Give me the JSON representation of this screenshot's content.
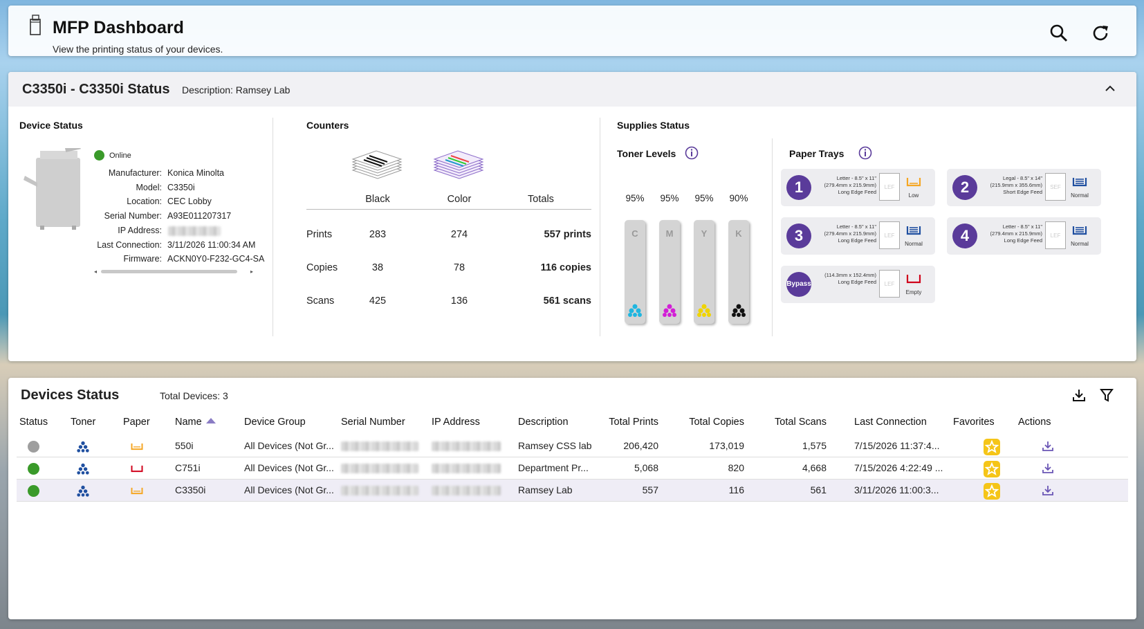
{
  "header": {
    "title": "MFP Dashboard",
    "subtitle": "View the printing status of your devices."
  },
  "device": {
    "title": "C3350i - C3350i Status",
    "description": "Description: Ramsey Lab",
    "status_heading": "Device Status",
    "online": "Online",
    "fields": [
      {
        "label": "Manufacturer:",
        "value": "Konica Minolta"
      },
      {
        "label": "Model:",
        "value": "C3350i"
      },
      {
        "label": "Location:",
        "value": "CEC Lobby"
      },
      {
        "label": "Serial Number:",
        "value": "A93E011207317"
      },
      {
        "label": "IP Address:",
        "value": ""
      },
      {
        "label": "Last Connection:",
        "value": "3/11/2026 11:00:34 AM"
      },
      {
        "label": "Firmware:",
        "value": "ACKN0Y0-F232-GC4-SA"
      }
    ]
  },
  "counters": {
    "heading": "Counters",
    "cols": [
      "Black",
      "Color",
      "Totals"
    ],
    "rows": [
      {
        "label": "Prints",
        "black": "283",
        "color": "274",
        "total": "557 prints"
      },
      {
        "label": "Copies",
        "black": "38",
        "color": "78",
        "total": "116 copies"
      },
      {
        "label": "Scans",
        "black": "425",
        "color": "136",
        "total": "561 scans"
      }
    ]
  },
  "supplies": {
    "heading": "Supplies Status",
    "toner_heading": "Toner Levels",
    "toners": [
      {
        "letter": "C",
        "pct": "95%",
        "color": "#1fb6e0"
      },
      {
        "letter": "M",
        "pct": "95%",
        "color": "#d21fd6"
      },
      {
        "letter": "Y",
        "pct": "95%",
        "color": "#f0d400"
      },
      {
        "letter": "K",
        "pct": "90%",
        "color": "#111111"
      }
    ],
    "trays_heading": "Paper Trays",
    "trays": [
      {
        "num": "1",
        "l1": "Letter - 8.5\" x 11\"",
        "l2": "(279.4mm x 215.9mm)",
        "l3": "Long Edge Feed",
        "feed": "LEF",
        "status": "Low"
      },
      {
        "num": "2",
        "l1": "Legal - 8.5\" x 14\"",
        "l2": "(215.9mm x 355.6mm)",
        "l3": "Short Edge Feed",
        "feed": "SEF",
        "status": "Normal"
      },
      {
        "num": "3",
        "l1": "Letter - 8.5\" x 11\"",
        "l2": "(279.4mm x 215.9mm)",
        "l3": "Long Edge Feed",
        "feed": "LEF",
        "status": "Normal"
      },
      {
        "num": "4",
        "l1": "Letter - 8.5\" x 11\"",
        "l2": "(279.4mm x 215.9mm)",
        "l3": "Long Edge Feed",
        "feed": "LEF",
        "status": "Normal"
      },
      {
        "num": "Bypass",
        "l1": "",
        "l2": "(114.3mm x 152.4mm)",
        "l3": "Long Edge Feed",
        "feed": "LEF",
        "status": "Empty"
      }
    ]
  },
  "list": {
    "title": "Devices Status",
    "total": "Total Devices: 3",
    "columns": [
      "Status",
      "Toner",
      "Paper",
      "Name",
      "Device Group",
      "Serial Number",
      "IP Address",
      "Description",
      "Total Prints",
      "Total Copies",
      "Total Scans",
      "Last Connection",
      "Favorites",
      "Actions"
    ],
    "rows": [
      {
        "status_color": "#9e9e9e",
        "paper_color": "#f5a623",
        "name": "550i",
        "group": "All Devices (Not Gr...",
        "desc": "Ramsey CSS lab",
        "prints": "206,420",
        "copies": "173,019",
        "scans": "1,575",
        "last": "7/15/2026 11:37:4..."
      },
      {
        "status_color": "#3a9a2a",
        "paper_color": "#d0021b",
        "name": "C751i",
        "group": "All Devices (Not Gr...",
        "desc": "Department Pr...",
        "prints": "5,068",
        "copies": "820",
        "scans": "4,668",
        "last": "7/15/2026 4:22:49 ..."
      },
      {
        "status_color": "#3a9a2a",
        "paper_color": "#f5a623",
        "name": "C3350i",
        "group": "All Devices (Not Gr...",
        "desc": "Ramsey Lab",
        "prints": "557",
        "copies": "116",
        "scans": "561",
        "last": "3/11/2026 11:00:3..."
      }
    ]
  },
  "colors": {
    "accent": "#5a3b9a",
    "tray_blue": "#1f4fa0",
    "toner_icon": "#1f4fa0"
  }
}
